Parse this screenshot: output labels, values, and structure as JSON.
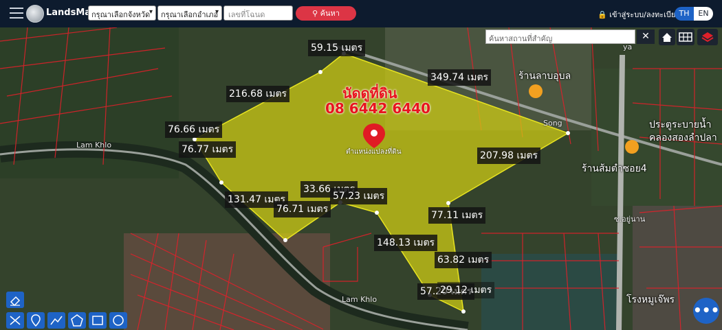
{
  "header": {
    "brand": "LandsMaps",
    "province_select": "กรุณาเลือกจังหวัด",
    "district_select": "กรุณาเลือกอำเภอ",
    "deed_placeholder": "เลขที่โฉนด",
    "search_label": "ค้นหา",
    "login_label": "เข้าสู่ระบบ/ลงทะเบียน",
    "lang_th": "TH",
    "lang_en": "EN"
  },
  "map": {
    "place_search_placeholder": "ค้นหาสถานที่สำคัญ",
    "contact_title": "นัดดูที่ดิน",
    "contact_phone": "08 6442 6440",
    "pin_label": "ตำแหน่งแปลงที่ดิน",
    "measurements": [
      "59.15 เมตร",
      "349.74 เมตร",
      "216.68 เมตร",
      "76.66 เมตร",
      "76.77 เมตร",
      "207.98 เมตร",
      "33.66 เมตร",
      "57.23 เมตร",
      "131.47 เมตร",
      "76.71 เมตร",
      "77.11 เมตร",
      "148.13 เมตร",
      "63.82 เมตร",
      "57.20 เมตร",
      "29.12 เมตร"
    ],
    "places": [
      "ร้านลาบอุบล",
      "ประตูระบายน้ำ",
      "คลองสองลำปลา",
      "ร้านส้มตำซอย4",
      "โรงหมูเจ๊พร"
    ],
    "roads": [
      "Lam Khlo",
      "Lam Khlo",
      "Song",
      "ya",
      "ซ.อยู่นาน"
    ],
    "colors": {
      "topbar": "#0d1b2e",
      "accent": "#dc3545",
      "plot_fill": "#d2d014",
      "boundary": "#e0202a",
      "tool_blue": "#1e63c6"
    }
  }
}
